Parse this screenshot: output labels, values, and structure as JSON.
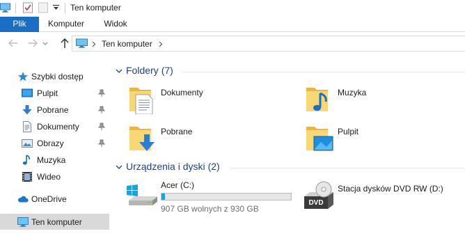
{
  "window": {
    "title": "Ten komputer"
  },
  "ribbon": {
    "tabs": [
      {
        "label": "Plik"
      },
      {
        "label": "Komputer"
      },
      {
        "label": "Widok"
      }
    ]
  },
  "address": {
    "path": "Ten komputer"
  },
  "sidebar": {
    "quick_access": "Szybki dostęp",
    "pinned": [
      {
        "label": "Pulpit",
        "icon": "desktop-icon",
        "pinned": true
      },
      {
        "label": "Pobrane",
        "icon": "download-icon",
        "pinned": true
      },
      {
        "label": "Dokumenty",
        "icon": "document-icon",
        "pinned": true
      },
      {
        "label": "Obrazy",
        "icon": "pictures-icon",
        "pinned": true
      },
      {
        "label": "Muzyka",
        "icon": "music-icon",
        "pinned": false
      },
      {
        "label": "Wideo",
        "icon": "video-icon",
        "pinned": false
      }
    ],
    "onedrive": "OneDrive",
    "this_pc": "Ten komputer"
  },
  "folders": {
    "header": "Foldery",
    "count": "(7)",
    "items": [
      {
        "label": "Dokumenty",
        "icon": "documents-folder-icon"
      },
      {
        "label": "Muzyka",
        "icon": "music-folder-icon"
      },
      {
        "label": "Pobrane",
        "icon": "downloads-folder-icon"
      },
      {
        "label": "Pulpit",
        "icon": "desktop-folder-icon"
      }
    ]
  },
  "devices": {
    "header": "Urządzenia i dyski",
    "count": "(2)",
    "drive_c": {
      "label": "Acer (C:)",
      "free_text": "907 GB wolnych z 930 GB",
      "used_fraction": 0.0247
    },
    "dvd": {
      "label": "Stacja dysków DVD RW (D:)",
      "badge": "DVD"
    }
  },
  "colors": {
    "accent": "#1a6fc4",
    "section_header": "#1e3f8a",
    "bar_fill": "#26a0da",
    "selected_bg": "#d9d9d9",
    "folder_yellow": "#f8d775"
  }
}
